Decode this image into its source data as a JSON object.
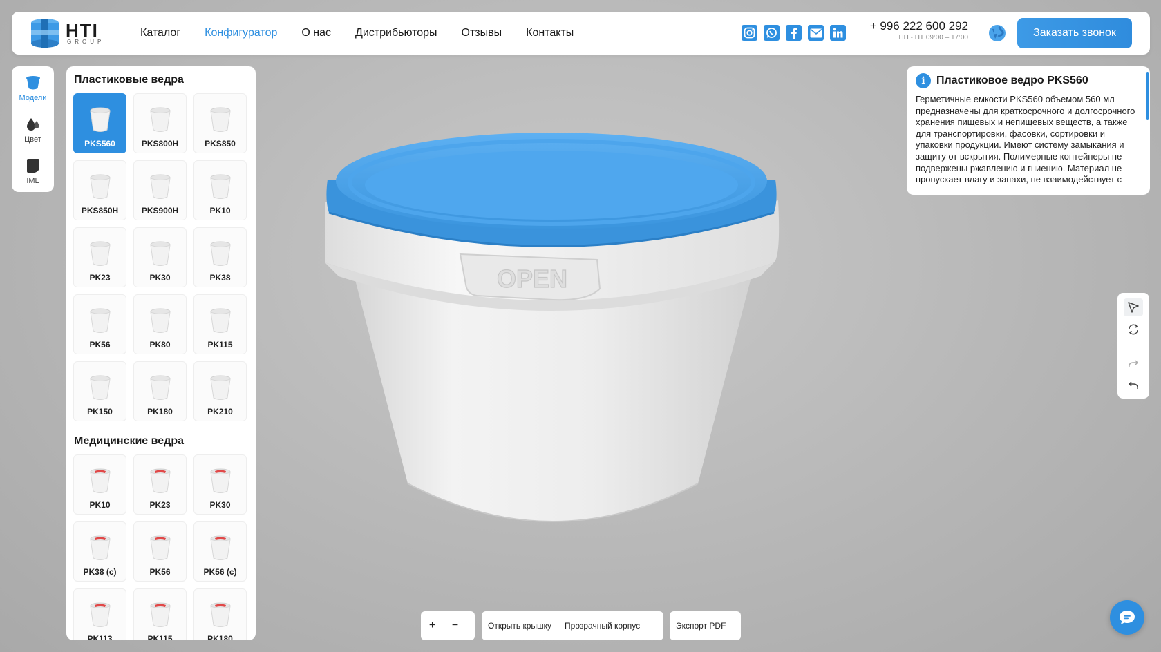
{
  "header": {
    "logo": {
      "text": "HTI",
      "subtext": "GROUP"
    },
    "nav": [
      {
        "label": "Каталог",
        "active": false
      },
      {
        "label": "Конфигуратор",
        "active": true
      },
      {
        "label": "О нас",
        "active": false
      },
      {
        "label": "Дистрибьюторы",
        "active": false
      },
      {
        "label": "Отзывы",
        "active": false
      },
      {
        "label": "Контакты",
        "active": false
      }
    ],
    "socials": [
      "instagram-icon",
      "whatsapp-icon",
      "facebook-icon",
      "mail-icon",
      "linkedin-icon"
    ],
    "phone": "+ 996 222 600 292",
    "hours": "ПН - ПТ 09:00 – 17:00",
    "cta": "Заказать звонок"
  },
  "rail": [
    {
      "label": "Модели",
      "icon": "bucket-icon",
      "active": true
    },
    {
      "label": "Цвет",
      "icon": "drops-icon",
      "active": false
    },
    {
      "label": "IML",
      "icon": "label-icon",
      "active": false
    }
  ],
  "models": {
    "plastic_title": "Пластиковые ведра",
    "plastic": [
      "PKS560",
      "PKS800H",
      "PKS850",
      "PKS850H",
      "PKS900H",
      "PK10",
      "PK23",
      "PK30",
      "PK38",
      "PK56",
      "PK80",
      "PK115",
      "PK150",
      "PK180",
      "PK210"
    ],
    "medical_title": "Медицинские ведра",
    "medical": [
      "PK10",
      "PK23",
      "PK30",
      "PK38 (c)",
      "PK56",
      "PK56 (c)",
      "PK113",
      "PK115",
      "PK180"
    ],
    "selected": "PKS560"
  },
  "info": {
    "title": "Пластиковое ведро PKS560",
    "text": "Герметичные емкости PKS560 объемом 560 мл предназначены для краткосрочного и долгосрочного хранения пищевых и непищевых веществ, а также для транспортировки, фасовки, сортировки и упаковки продукции. Имеют систему замыкания и защиту от вскрытия. Полимерные контейнеры не подвержены ржавлению и гниению. Материал не пропускает влагу и запахи, не взаимодействует с"
  },
  "viewer": {
    "lid_text": "OPEN",
    "lid_color": "#3d9ae6",
    "body_color": "#ececec"
  },
  "tools": [
    "cursor-icon",
    "rotate-icon",
    "redo-icon",
    "undo-icon"
  ],
  "toolbar": {
    "zoom_in": "+",
    "zoom_out": "−",
    "open_lid": "Открыть крышку",
    "transparent": "Прозрачный корпус",
    "export": "Экспорт PDF"
  },
  "colors": {
    "accent": "#2e8fe0"
  }
}
